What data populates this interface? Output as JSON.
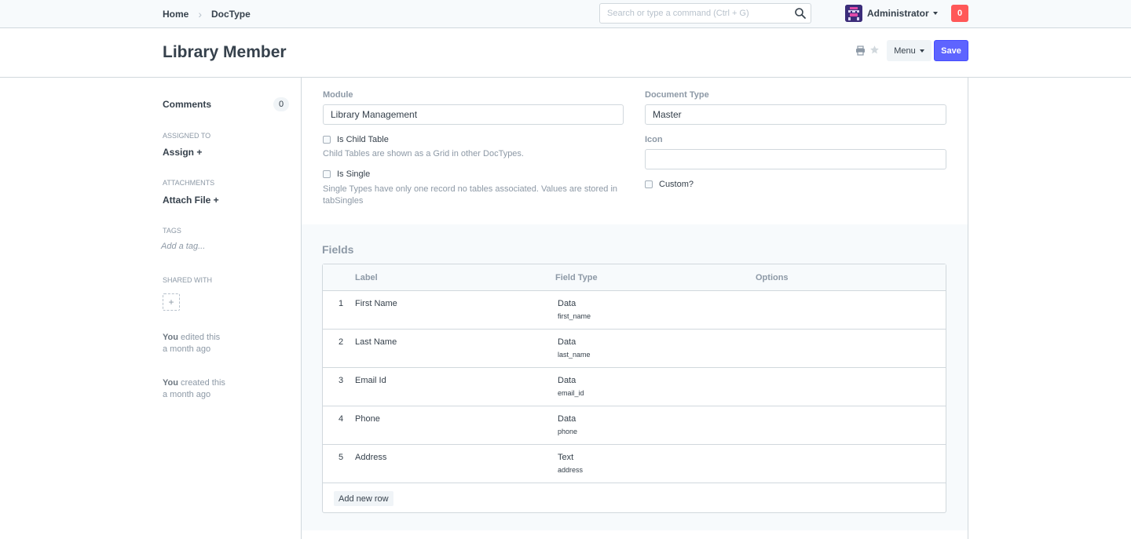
{
  "navbar": {
    "breadcrumbs": [
      "Home",
      "DocType"
    ],
    "search_placeholder": "Search or type a command (Ctrl + G)",
    "user_name": "Administrator",
    "notification_count": "0"
  },
  "page": {
    "title": "Library Member",
    "menu_label": "Menu",
    "save_label": "Save"
  },
  "sidebar": {
    "comments_label": "Comments",
    "comments_count": "0",
    "assigned_to_label": "ASSIGNED TO",
    "assign_link": "Assign +",
    "attachments_label": "ATTACHMENTS",
    "attach_link": "Attach File +",
    "tags_label": "TAGS",
    "tag_placeholder": "Add a tag...",
    "shared_with_label": "SHARED WITH",
    "share_add": "+",
    "activity": [
      {
        "who": "You",
        "what": "edited this",
        "when": "a month ago"
      },
      {
        "who": "You",
        "what": "created this",
        "when": "a month ago"
      }
    ]
  },
  "form": {
    "module_label": "Module",
    "module_value": "Library Management",
    "is_child_table_label": "Is Child Table",
    "is_child_table_help": "Child Tables are shown as a Grid in other DocTypes.",
    "is_single_label": "Is Single",
    "is_single_help_line1": "Single Types have only one record no tables associated. Values are stored in",
    "is_single_help_line2": "tabSingles",
    "document_type_label": "Document Type",
    "document_type_value": "Master",
    "icon_label": "Icon",
    "icon_value": "",
    "custom_label": "Custom?"
  },
  "fields": {
    "section_title": "Fields",
    "columns": [
      "Label",
      "Field Type",
      "Options"
    ],
    "rows": [
      {
        "idx": "1",
        "label": "First Name",
        "fieldtype": "Data",
        "fieldname": "first_name"
      },
      {
        "idx": "2",
        "label": "Last Name",
        "fieldtype": "Data",
        "fieldname": "last_name"
      },
      {
        "idx": "3",
        "label": "Email Id",
        "fieldtype": "Data",
        "fieldname": "email_id"
      },
      {
        "idx": "4",
        "label": "Phone",
        "fieldtype": "Data",
        "fieldname": "phone"
      },
      {
        "idx": "5",
        "label": "Address",
        "fieldtype": "Text",
        "fieldname": "address"
      }
    ],
    "add_row_label": "Add new row"
  },
  "colors": {
    "primary": "#5e64ff",
    "notification": "#ff5858",
    "text": "#36414c",
    "muted": "#8d99a6",
    "border": "#d1d8dd"
  }
}
